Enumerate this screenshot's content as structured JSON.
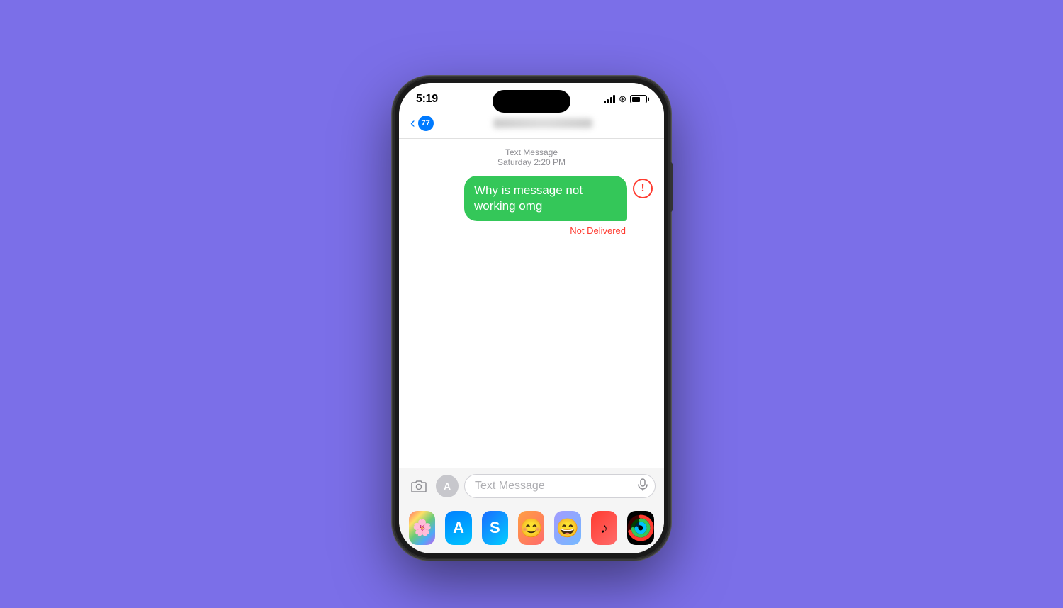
{
  "background_color": "#7B6FE8",
  "phone": {
    "status_bar": {
      "time": "5:19",
      "battery_level": "61"
    },
    "nav_bar": {
      "back_badge": "77",
      "contact_name": "[blurred]"
    },
    "messages": {
      "timestamp_label": "Text Message",
      "timestamp_date": "Saturday 2:20 PM",
      "bubble_text": "Why is message not working omg",
      "bubble_color": "#34C759",
      "error_indicator": "!",
      "not_delivered_label": "Not Delivered",
      "not_delivered_color": "#FF3B30"
    },
    "input_bar": {
      "placeholder": "Text Message"
    },
    "dock": {
      "apps": [
        {
          "name": "Photos",
          "key": "photos"
        },
        {
          "name": "App Store",
          "key": "appstore"
        },
        {
          "name": "Shazam",
          "key": "shazam"
        },
        {
          "name": "Memoji 1",
          "key": "memoji1"
        },
        {
          "name": "Memoji 2",
          "key": "memoji2"
        },
        {
          "name": "Music",
          "key": "music"
        },
        {
          "name": "Activity",
          "key": "activity"
        }
      ]
    }
  }
}
